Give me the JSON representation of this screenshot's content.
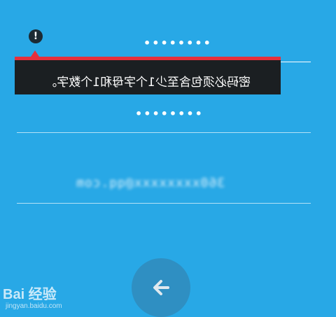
{
  "password_field": {
    "value": "••••••••"
  },
  "error_tooltip": {
    "message": "密码必须包含至少1个字母和1个数字。",
    "accent_color": "#e6303b",
    "icon": "exclamation-icon"
  },
  "confirm_field": {
    "value": "••••••••"
  },
  "email_field": {
    "value": "360xxxxxxxx@qq.com"
  },
  "back_button": {
    "icon": "arrow-left-icon"
  },
  "watermark": {
    "logo": "Bai 经验",
    "url": "jingyan.baidu.com"
  },
  "colors": {
    "background": "#28a8e6",
    "button": "#2f8fc2"
  }
}
